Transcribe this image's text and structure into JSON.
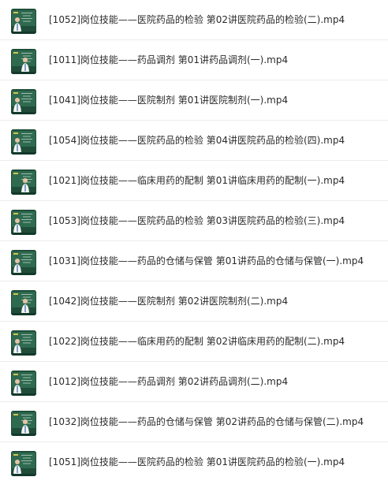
{
  "files": [
    {
      "name": "[1052]岗位技能——医院药品的检验 第02讲医院药品的检验(二).mp4",
      "thumbnail": "video-thumbnail-icon"
    },
    {
      "name": "[1011]岗位技能——药品调剂 第01讲药品调剂(一).mp4",
      "thumbnail": "video-thumbnail-icon"
    },
    {
      "name": "[1041]岗位技能——医院制剂 第01讲医院制剂(一).mp4",
      "thumbnail": "video-thumbnail-icon"
    },
    {
      "name": "[1054]岗位技能——医院药品的检验 第04讲医院药品的检验(四).mp4",
      "thumbnail": "video-thumbnail-icon"
    },
    {
      "name": "[1021]岗位技能——临床用药的配制 第01讲临床用药的配制(一).mp4",
      "thumbnail": "video-thumbnail-icon"
    },
    {
      "name": "[1053]岗位技能——医院药品的检验 第03讲医院药品的检验(三).mp4",
      "thumbnail": "video-thumbnail-icon"
    },
    {
      "name": "[1031]岗位技能——药品的仓储与保管 第01讲药品的仓储与保管(一).mp4",
      "thumbnail": "video-thumbnail-icon"
    },
    {
      "name": "[1042]岗位技能——医院制剂 第02讲医院制剂(二).mp4",
      "thumbnail": "video-thumbnail-icon"
    },
    {
      "name": "[1022]岗位技能——临床用药的配制 第02讲临床用药的配制(二).mp4",
      "thumbnail": "video-thumbnail-icon"
    },
    {
      "name": "[1012]岗位技能——药品调剂 第02讲药品调剂(二).mp4",
      "thumbnail": "video-thumbnail-icon"
    },
    {
      "name": "[1032]岗位技能——药品的仓储与保管 第02讲药品的仓储与保管(二).mp4",
      "thumbnail": "video-thumbnail-icon"
    },
    {
      "name": "[1051]岗位技能——医院药品的检验 第01讲医院药品的检验(一).mp4",
      "thumbnail": "video-thumbnail-icon"
    }
  ],
  "colors": {
    "thumb_bg": "#1f4d3a",
    "thumb_board": "#2e6a4f",
    "text": "#2b2b2b",
    "divider": "#ececec"
  }
}
